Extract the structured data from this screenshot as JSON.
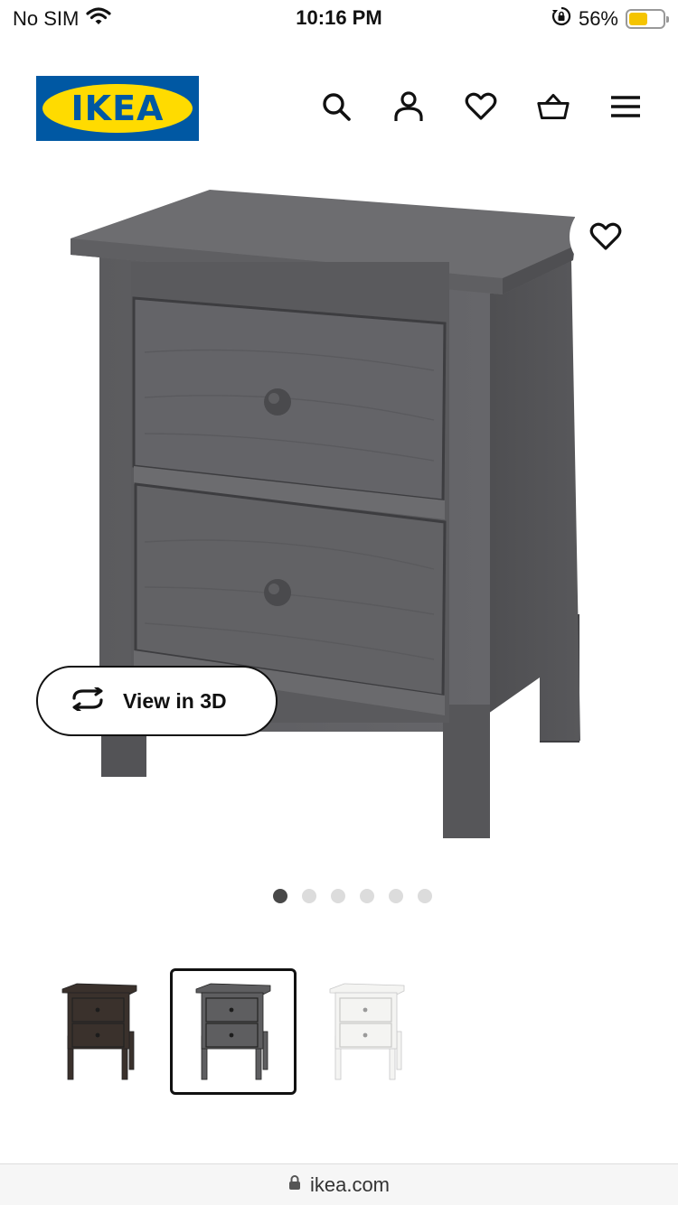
{
  "status_bar": {
    "carrier": "No SIM",
    "time": "10:16 PM",
    "battery_percent": "56%",
    "battery_level": 0.56,
    "battery_color": "#f5c400"
  },
  "header": {
    "logo_text": "IKEA",
    "logo_colors": {
      "background": "#0058a3",
      "oval": "#ffdb00"
    },
    "icons": [
      "search-icon",
      "account-icon",
      "heart-icon",
      "basket-icon",
      "menu-icon"
    ]
  },
  "product": {
    "view_3d_label": "View in 3D",
    "image_pages": 6,
    "active_image_index": 0,
    "variants": [
      {
        "name": "black-brown",
        "color": "#3a312c",
        "selected": false
      },
      {
        "name": "dark-grey",
        "color": "#5e5e60",
        "selected": true
      },
      {
        "name": "white",
        "color": "#f4f4f2",
        "selected": false
      }
    ]
  },
  "browser": {
    "url": "ikea.com"
  }
}
